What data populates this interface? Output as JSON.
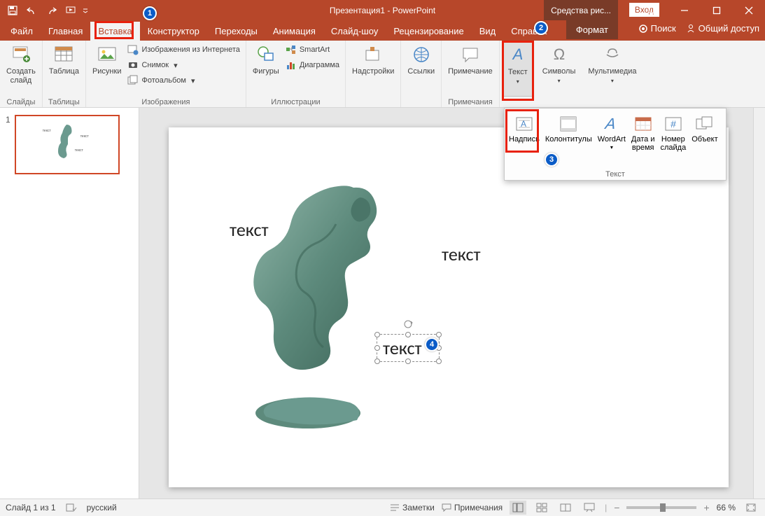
{
  "title": "Презентация1 - PowerPoint",
  "context_tool": "Средства рис...",
  "login": "Вход",
  "tabs": {
    "file": "Файл",
    "home": "Главная",
    "insert": "Вставка",
    "design": "Конструктор",
    "transitions": "Переходы",
    "animations": "Анимация",
    "slideshow": "Слайд-шоу",
    "review": "Рецензирование",
    "view": "Вид",
    "help": "Справка",
    "format": "Формат"
  },
  "search": "Поиск",
  "share": "Общий доступ",
  "ribbon": {
    "new_slide": "Создать\nслайд",
    "table": "Таблица",
    "pictures": "Рисунки",
    "online_images": "Изображения из Интернета",
    "screenshot": "Снимок",
    "photo_album": "Фотоальбом",
    "shapes": "Фигуры",
    "smartart": "SmartArt",
    "chart": "Диаграмма",
    "addins": "Надстройки",
    "links": "Ссылки",
    "comment": "Примечание",
    "text": "Текст",
    "symbols": "Символы",
    "media": "Мультимедиа",
    "g_slides": "Слайды",
    "g_tables": "Таблицы",
    "g_images": "Изображения",
    "g_illustrations": "Иллюстрации",
    "g_comments": "Примечания"
  },
  "dropdown": {
    "textbox": "Надпись",
    "header_footer": "Колонтитулы",
    "wordart": "WordArt",
    "date_time": "Дата и\nвремя",
    "slide_number": "Номер\nслайда",
    "object": "Объект",
    "group_label": "Текст"
  },
  "slide_text": {
    "t1": "текст",
    "t2": "текст",
    "t3": "текст"
  },
  "thumb": {
    "num": "1"
  },
  "status": {
    "slide_info": "Слайд 1 из 1",
    "lang": "русский",
    "notes": "Заметки",
    "comments": "Примечания",
    "zoom": "66 %"
  },
  "badges": {
    "b1": "1",
    "b2": "2",
    "b3": "3",
    "b4": "4"
  }
}
